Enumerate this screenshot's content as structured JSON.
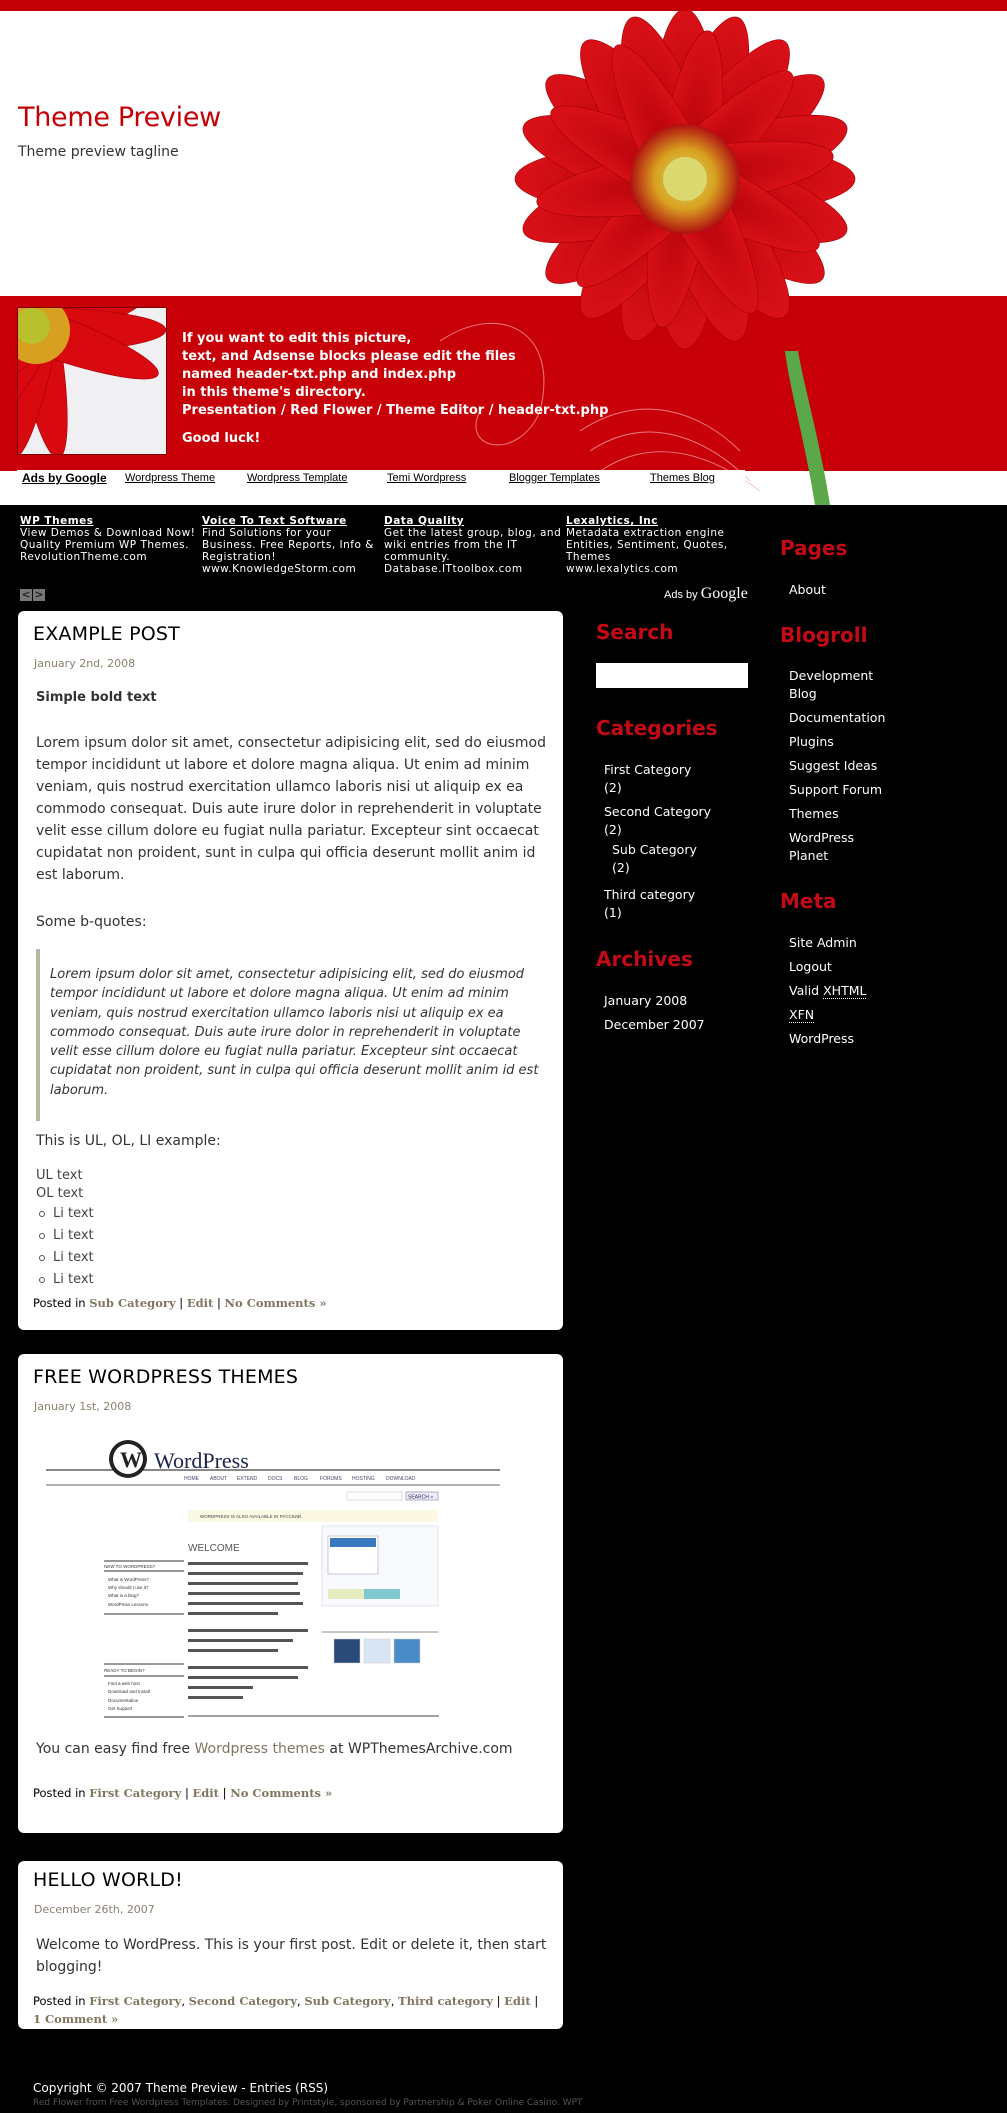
{
  "header": {
    "title": "Theme Preview",
    "tagline": "Theme preview tagline",
    "message_lines": [
      "If you want to edit this picture,",
      "text, and Adsense blocks please edit the files",
      "named header-txt.php and index.php",
      "in this theme's directory.",
      "Presentation / Red Flower / Theme Editor / header-txt.php"
    ],
    "message_closing": "Good luck!",
    "brand_color": "#c40006"
  },
  "ad_links_bar": {
    "label": "Ads by Google",
    "links": [
      "Wordpress Theme",
      "Wordpress Template",
      "Temi Wordpress",
      "Blogger Templates",
      "Themes Blog"
    ]
  },
  "ad_units": [
    {
      "title": "WP Themes",
      "lines": [
        "View Demos & Download Now!",
        "Quality Premium WP Themes.",
        "RevolutionTheme.com"
      ]
    },
    {
      "title": "Voice To Text Software",
      "lines": [
        "Find Solutions for your",
        "Business. Free Reports, Info &",
        "Registration!",
        "www.KnowledgeStorm.com"
      ]
    },
    {
      "title": "Data Quality",
      "lines": [
        "Get the latest group, blog, and",
        "wiki entries from the IT",
        "community.",
        "Database.ITtoolbox.com"
      ]
    },
    {
      "title": "Lexalytics, Inc",
      "lines": [
        "Metadata extraction engine",
        "Entities, Sentiment, Quotes,",
        "Themes",
        "www.lexalytics.com"
      ]
    }
  ],
  "ads_by_google": {
    "prefix": "Ads by",
    "brand": "Google"
  },
  "ad_nav": {
    "prev": "<",
    "next": ">"
  },
  "posts": [
    {
      "title": "EXAMPLE POST",
      "date": "January 2nd, 2008",
      "bold_text": "Simple bold text",
      "paragraph": "Lorem ipsum dolor sit amet, consectetur adipisicing elit, sed do eiusmod tempor incididunt ut labore et dolore magna aliqua. Ut enim ad minim veniam, quis nostrud exercitation ullamco laboris nisi ut aliquip ex ea commodo consequat. Duis aute irure dolor in reprehenderit in voluptate velit esse cillum dolore eu fugiat nulla pariatur. Excepteur sint occaecat cupidatat non proident, sunt in culpa qui officia deserunt mollit anim id est laborum.",
      "bquote_intro": "Some b-quotes:",
      "blockquote": "Lorem ipsum dolor sit amet, consectetur adipisicing elit, sed do eiusmod tempor incididunt ut labore et dolore magna aliqua. Ut enim ad minim veniam, quis nostrud exercitation ullamco laboris nisi ut aliquip ex ea commodo consequat. Duis aute irure dolor in reprehenderit in voluptate velit esse cillum dolore eu fugiat nulla pariatur. Excepteur sint occaecat cupidatat non proident, sunt in culpa qui officia deserunt mollit anim id est laborum.",
      "list_intro": "This is UL, OL, LI example:",
      "ul_text": "UL text",
      "ol_text": "OL text",
      "li_items": [
        "Li text",
        "Li text",
        "Li text",
        "Li text"
      ],
      "posted_in": "Posted in",
      "categories": [
        "Sub Category"
      ],
      "edit": "Edit",
      "comments": "No Comments »"
    },
    {
      "title": "FREE WORDPRESS THEMES",
      "date": "January 1st, 2008",
      "image_alt": "WordPress homepage screenshot",
      "screenshot": {
        "logo": "WordPress",
        "nav": [
          "HOME",
          "ABOUT",
          "EXTEND",
          "DOCS",
          "BLOG",
          "FORUMS",
          "HOSTING",
          "DOWNLOAD"
        ],
        "search_button": "SEARCH »",
        "notice": "WORDPRESS IS ALSO AVAILABLE IN РУССКИЙ.",
        "welcome": "WELCOME",
        "new_heading": "NEW TO WORDPRESS?",
        "new_links": [
          "What is WordPress?",
          "Why should I use it?",
          "What is a blog?",
          "WordPress Lessons"
        ],
        "ready_heading": "READY TO BEGIN?",
        "ready_links": [
          "Find a web host",
          "Download and Install",
          "Documentation",
          "Get Support"
        ]
      },
      "text_before": "You can easy find free ",
      "link_text": "Wordpress themes",
      "text_after": " at WPThemesArchive.com",
      "posted_in": "Posted in",
      "categories": [
        "First Category"
      ],
      "edit": "Edit",
      "comments": "No Comments »"
    },
    {
      "title": "HELLO WORLD!",
      "date": "December 26th, 2007",
      "paragraph": "Welcome to WordPress. This is your first post. Edit or delete it, then start blogging!",
      "posted_in": "Posted in",
      "categories": [
        "First Category",
        "Second Category",
        "Sub Category",
        "Third category"
      ],
      "edit": "Edit",
      "comments": "1 Comment »"
    }
  ],
  "sidebar_left": {
    "search_heading": "Search",
    "search_value": "",
    "categories_heading": "Categories",
    "categories": [
      {
        "label": "First Category",
        "count": "(2)"
      },
      {
        "label": "Second Category",
        "count": "(2)"
      },
      {
        "label": "Sub Category",
        "count": "(2)"
      },
      {
        "label": "Third category",
        "count": "(1)"
      }
    ],
    "archives_heading": "Archives",
    "archives": [
      "January 2008",
      "December 2007"
    ]
  },
  "sidebar_right": {
    "pages_heading": "Pages",
    "pages": [
      "About"
    ],
    "blogroll_heading": "Blogroll",
    "blogroll": [
      "Development Blog",
      "Documentation",
      "Plugins",
      "Suggest Ideas",
      "Support Forum",
      "Themes",
      "WordPress Planet"
    ],
    "meta_heading": "Meta",
    "meta": {
      "site_admin": "Site Admin",
      "logout": "Logout",
      "valid_prefix": "Valid ",
      "xhtml": "XHTML",
      "xfn": "XFN",
      "wordpress": "WordPress"
    }
  },
  "footer": {
    "copyright": "Copyright © 2007 Theme Preview - Entries (RSS)",
    "credit": "Red Flower from Free Wordpress Templates. Designed by Printstyle, sponsored by Partnership & Poker Online Casino. WPT"
  }
}
